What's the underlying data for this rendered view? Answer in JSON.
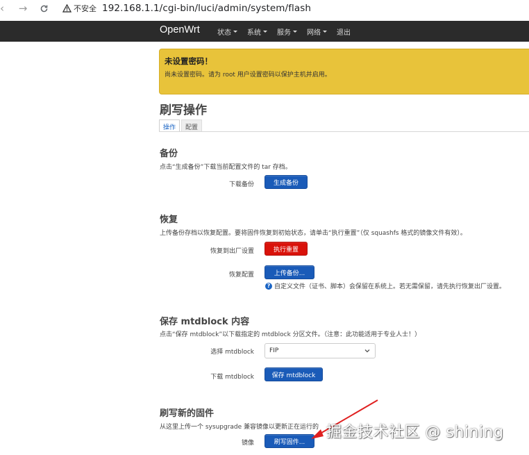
{
  "browser": {
    "security_label": "不安全",
    "url": "192.168.1.1/cgi-bin/luci/admin/system/flash"
  },
  "topnav": {
    "brand": "OpenWrt",
    "menu": [
      "状态",
      "系统",
      "服务",
      "网络",
      "退出"
    ]
  },
  "alert": {
    "title": "未设置密码！",
    "text": "尚未设置密码。请为 root 用户设置密码以保护主机并启用。"
  },
  "page": {
    "title": "刷写操作",
    "tabs": [
      "操作",
      "配置"
    ]
  },
  "backup": {
    "title": "备份",
    "desc": "点击“生成备份”下载当前配置文件的 tar 存档。",
    "label": "下载备份",
    "button": "生成备份"
  },
  "restore": {
    "title": "恢复",
    "desc": "上传备份存档以恢复配置。要将固件恢复到初始状态，请单击“执行重置”（仅 squashfs 格式的镜像文件有效）。",
    "reset_label": "恢复到出厂设置",
    "reset_button": "执行重置",
    "restore_label": "恢复配置",
    "upload_button": "上传备份...",
    "hint": "自定义文件（证书、脚本）会保留在系统上。若无需保留，请先执行恢复出厂设置。"
  },
  "mtd": {
    "title": "保存 mtdblock 内容",
    "desc": "点击“保存 mtdblock”以下载指定的 mtdblock 分区文件。（注意：此功能适用于专业人士！）",
    "select_label": "选择 mtdblock",
    "select_value": "FIP",
    "download_label": "下载 mtdblock",
    "save_button": "保存 mtdblock"
  },
  "flash": {
    "title": "刷写新的固件",
    "desc": "从这里上传一个 sysupgrade 兼容镜像以更新正在运行的",
    "image_label": "镜像",
    "flash_button": "刷写固件..."
  },
  "watermark": "掘金技术社区 @ shining",
  "colors": {
    "topnav_bg": "#2b2b2b",
    "alert_bg": "#e8c33a",
    "primary_button": "#1a5bb8",
    "danger_button": "#d9120a",
    "annotation_arrow": "#e02020"
  }
}
